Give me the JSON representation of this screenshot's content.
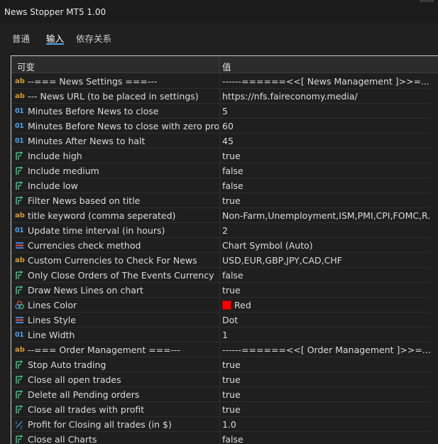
{
  "window": {
    "title": "News Stopper MT5 1.00"
  },
  "tabs": [
    {
      "label": "普通"
    },
    {
      "label": "输入"
    },
    {
      "label": "依存关系"
    }
  ],
  "grid": {
    "columns": {
      "variable": "可变",
      "value": "值"
    },
    "rows": [
      {
        "type": "string",
        "name": "--=== News Settings ===---",
        "value": "------======<<[  News Management  ]>>=..."
      },
      {
        "type": "string",
        "name": "--- News URL (to be placed in settings)",
        "value": "https://nfs.faireconomy.media/"
      },
      {
        "type": "int",
        "name": "Minutes Before News to close",
        "value": "5"
      },
      {
        "type": "int",
        "name": "Minutes Before News to close with zero pro...",
        "value": "60"
      },
      {
        "type": "int",
        "name": "Minutes After News to halt",
        "value": "45"
      },
      {
        "type": "bool",
        "name": "Include high",
        "value": "true"
      },
      {
        "type": "bool",
        "name": "Include medium",
        "value": "false"
      },
      {
        "type": "bool",
        "name": "Include low",
        "value": "false"
      },
      {
        "type": "bool",
        "name": "Filter News based on title",
        "value": "true"
      },
      {
        "type": "string",
        "name": "title keyword (comma seperated)",
        "value": "Non-Farm,Unemployment,ISM,PMI,CPI,FOMC,R..."
      },
      {
        "type": "int",
        "name": "Update time interval (in hours)",
        "value": "2"
      },
      {
        "type": "enum",
        "name": "Currencies check method",
        "value": "Chart Symbol (Auto)"
      },
      {
        "type": "string",
        "name": "Custom Currencies to Check For News",
        "value": "USD,EUR,GBP,JPY,CAD,CHF"
      },
      {
        "type": "bool",
        "name": "Only Close Orders of The Events Currency",
        "value": "false"
      },
      {
        "type": "bool",
        "name": "Draw News Lines on chart",
        "value": "true"
      },
      {
        "type": "color",
        "name": "Lines Color",
        "value": "Red",
        "swatch": "#ff0000"
      },
      {
        "type": "enum",
        "name": "Lines Style",
        "value": "Dot"
      },
      {
        "type": "int",
        "name": "Line Width",
        "value": "1"
      },
      {
        "type": "string",
        "name": "--=== Order Management ===---",
        "value": "------======<<[  Order Management  ]>>=..."
      },
      {
        "type": "bool",
        "name": "Stop Auto trading",
        "value": "true"
      },
      {
        "type": "bool",
        "name": "Close all open trades",
        "value": "true"
      },
      {
        "type": "bool",
        "name": "Delete all Pending orders",
        "value": "true"
      },
      {
        "type": "bool",
        "name": "Close all trades with profit",
        "value": "true"
      },
      {
        "type": "double",
        "name": "Profit for Closing all trades (in $)",
        "value": "1.0"
      },
      {
        "type": "bool",
        "name": "Close all Charts",
        "value": "false"
      }
    ]
  },
  "icons": {
    "string": "ab-string-icon",
    "int": "int-01-icon",
    "bool": "bool-arrow-icon",
    "enum": "enum-list-icon",
    "color": "color-palette-icon",
    "double": "double-half-icon"
  },
  "colors": {
    "accent": "#4ea3e6",
    "string_icon": "#d99a2b",
    "int_icon": "#4aa3f0",
    "bool_icon": "#3fbf7f"
  }
}
